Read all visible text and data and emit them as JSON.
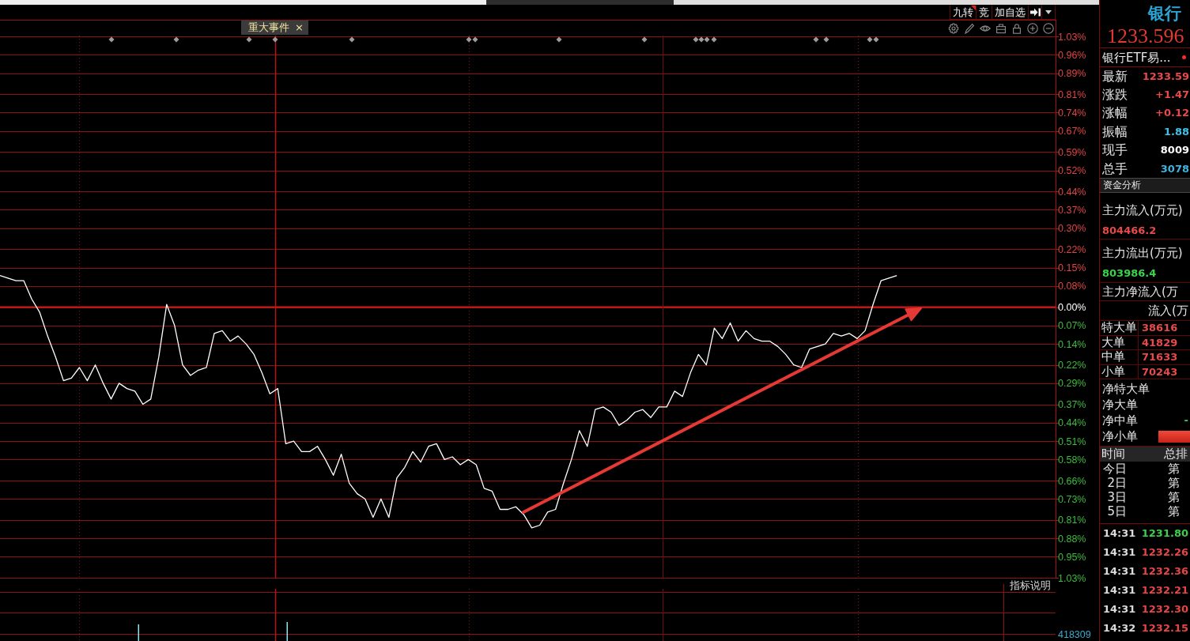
{
  "toolbar": {
    "buttons": [
      {
        "label": "九转",
        "flagged": true
      },
      {
        "label": "竞",
        "flagged": false
      },
      {
        "label": "加自选",
        "flagged": false
      }
    ]
  },
  "event_tag": {
    "label": "重大事件",
    "close": "×"
  },
  "chart": {
    "trend_arrow": true,
    "chart_data": [
      {
        "type": "line",
        "color": "#ffffff",
        "grid": true,
        "ylim": [
          -1.03,
          1.03
        ],
        "yticks": [
          {
            "value": 1.03,
            "label": "1.03%"
          },
          {
            "value": 0.96,
            "label": "0.96%"
          },
          {
            "value": 0.89,
            "label": "0.89%"
          },
          {
            "value": 0.81,
            "label": "0.81%"
          },
          {
            "value": 0.74,
            "label": "0.74%"
          },
          {
            "value": 0.67,
            "label": "0.67%"
          },
          {
            "value": 0.59,
            "label": "0.59%"
          },
          {
            "value": 0.52,
            "label": "0.52%"
          },
          {
            "value": 0.44,
            "label": "0.44%"
          },
          {
            "value": 0.37,
            "label": "0.37%"
          },
          {
            "value": 0.3,
            "label": "0.30%"
          },
          {
            "value": 0.22,
            "label": "0.22%"
          },
          {
            "value": 0.15,
            "label": "0.15%"
          },
          {
            "value": 0.08,
            "label": "0.08%"
          },
          {
            "value": 0,
            "label": "0.00%"
          },
          {
            "value": -0.07,
            "label": "0.07%"
          },
          {
            "value": -0.14,
            "label": "0.14%"
          },
          {
            "value": -0.22,
            "label": "0.22%"
          },
          {
            "value": -0.29,
            "label": "0.29%"
          },
          {
            "value": -0.37,
            "label": "0.37%"
          },
          {
            "value": -0.44,
            "label": "0.44%"
          },
          {
            "value": -0.51,
            "label": "0.51%"
          },
          {
            "value": -0.58,
            "label": "0.58%"
          },
          {
            "value": -0.66,
            "label": "0.66%"
          },
          {
            "value": -0.73,
            "label": "0.73%"
          },
          {
            "value": -0.81,
            "label": "0.81%"
          },
          {
            "value": -0.88,
            "label": "0.88%"
          },
          {
            "value": -0.95,
            "label": "0.95%"
          },
          {
            "value": -1.03,
            "label": "1.03%"
          }
        ],
        "ref_lines": [
          {
            "axis": "y",
            "value": 0,
            "color": "#c81a1a"
          }
        ],
        "categories": [
          null,
          null,
          null,
          null,
          null,
          null,
          null,
          null,
          null,
          null,
          null,
          null,
          null,
          null,
          null,
          null,
          null,
          null,
          null,
          null,
          null,
          null,
          null,
          null,
          null,
          null,
          null,
          null,
          null,
          null,
          null,
          null,
          null,
          null,
          null,
          null,
          null,
          null,
          null,
          null,
          null,
          null,
          null,
          null,
          null,
          null,
          null,
          null,
          null,
          null,
          null,
          null,
          null,
          null,
          null,
          null,
          null,
          null,
          null,
          null,
          null,
          null,
          null,
          null,
          null,
          null,
          null,
          null,
          null,
          null,
          null,
          null,
          null,
          null,
          null,
          null,
          null,
          null,
          null,
          null,
          null,
          null,
          null,
          null,
          null,
          null,
          null,
          null,
          null,
          null,
          null,
          null,
          null,
          null,
          null,
          null,
          null,
          null,
          null,
          null,
          null,
          null,
          null,
          null,
          null,
          null,
          null,
          null,
          null,
          null,
          null,
          null,
          null,
          null,
          null,
          null,
          null,
          null,
          null,
          null,
          null,
          null,
          null,
          null,
          null,
          null,
          null,
          null,
          null,
          null,
          null,
          null,
          null,
          null
        ],
        "values": [
          0.12,
          0.11,
          0.1,
          0.1,
          0.03,
          -0.02,
          -0.11,
          -0.19,
          -0.28,
          -0.27,
          -0.23,
          -0.28,
          -0.22,
          -0.29,
          -0.35,
          -0.29,
          -0.31,
          -0.32,
          -0.37,
          -0.35,
          -0.19,
          0.01,
          -0.07,
          -0.22,
          -0.26,
          -0.24,
          -0.23,
          -0.1,
          -0.09,
          -0.13,
          -0.11,
          -0.14,
          -0.18,
          -0.25,
          -0.33,
          -0.31,
          -0.52,
          -0.51,
          -0.55,
          -0.55,
          -0.53,
          -0.58,
          -0.64,
          -0.56,
          -0.67,
          -0.71,
          -0.73,
          -0.8,
          -0.73,
          -0.8,
          -0.65,
          -0.61,
          -0.55,
          -0.59,
          -0.53,
          -0.52,
          -0.58,
          -0.57,
          -0.6,
          -0.58,
          -0.6,
          -0.69,
          -0.7,
          -0.77,
          -0.77,
          -0.76,
          -0.79,
          -0.84,
          -0.83,
          -0.78,
          -0.77,
          -0.67,
          -0.58,
          -0.47,
          -0.53,
          -0.39,
          -0.38,
          -0.4,
          -0.45,
          -0.43,
          -0.4,
          -0.39,
          -0.42,
          -0.38,
          -0.38,
          -0.32,
          -0.34,
          -0.25,
          -0.18,
          -0.22,
          -0.08,
          -0.12,
          -0.06,
          -0.13,
          -0.09,
          -0.12,
          -0.13,
          -0.13,
          -0.15,
          -0.18,
          -0.22,
          -0.23,
          -0.16,
          -0.15,
          -0.14,
          -0.1,
          -0.11,
          -0.1,
          -0.12,
          -0.09,
          0.01,
          0.1,
          0.11,
          0.12,
          null,
          null,
          null,
          null,
          null,
          null,
          null,
          null,
          null,
          null,
          null,
          null,
          null,
          null,
          null,
          null,
          null,
          null,
          null,
          null
        ]
      }
    ]
  },
  "volume_pane": {
    "help_label": "指标说明",
    "axis_label": "418309"
  },
  "quote": {
    "name": "银行",
    "price": "1233.596",
    "subtitle": "银行ETF易...",
    "marked": true,
    "fields": [
      {
        "label": "最新",
        "value": "1233.59",
        "color": "#e84a4a"
      },
      {
        "label": "涨跌",
        "value": "+1.47",
        "color": "#e84a4a"
      },
      {
        "label": "涨幅",
        "value": "+0.12",
        "color": "#e84a4a"
      },
      {
        "label": "振幅",
        "value": "1.88",
        "color": "#3fc1e8"
      },
      {
        "label": "现手",
        "value": "8009",
        "color": "#ffffff"
      },
      {
        "label": "总手",
        "value": "3078",
        "color": "#3fb4e0"
      }
    ]
  },
  "fund_flow": {
    "title": "资金分析",
    "inflow": {
      "label": "主力流入(万元)",
      "value": "804466.2"
    },
    "outflow": {
      "label": "主力流出(万元)",
      "value": "803986.4"
    },
    "net_label": "主力净流入(万",
    "table": {
      "header": "流入(万",
      "rows": [
        {
          "label": "特大单",
          "value": "38616"
        },
        {
          "label": "大单",
          "value": "41829"
        },
        {
          "label": "中单",
          "value": "71633"
        },
        {
          "label": "小单",
          "value": "70243"
        }
      ]
    },
    "net_rows": [
      {
        "label": "净特大单"
      },
      {
        "label": "净大单"
      },
      {
        "label": "净中单",
        "value": "-"
      },
      {
        "label": "净小单",
        "level": 1
      }
    ]
  },
  "ranking": {
    "headers": [
      "时间",
      "总排"
    ],
    "rows": [
      {
        "period": "今日",
        "rank": "第"
      },
      {
        "period": "2日",
        "rank": "第"
      },
      {
        "period": "3日",
        "rank": "第"
      },
      {
        "period": "5日",
        "rank": "第"
      }
    ]
  },
  "trades": [
    {
      "time": "14:31",
      "price": "1231.80",
      "color": "#3ccf4e"
    },
    {
      "time": "14:31",
      "price": "1232.26",
      "color": "#e64545"
    },
    {
      "time": "14:31",
      "price": "1232.36",
      "color": "#e64545"
    },
    {
      "time": "14:31",
      "price": "1232.21",
      "color": "#e64545"
    },
    {
      "time": "14:31",
      "price": "1232.30",
      "color": "#e64545"
    },
    {
      "time": "14:32",
      "price": "1232.15",
      "color": "#e64545"
    }
  ]
}
